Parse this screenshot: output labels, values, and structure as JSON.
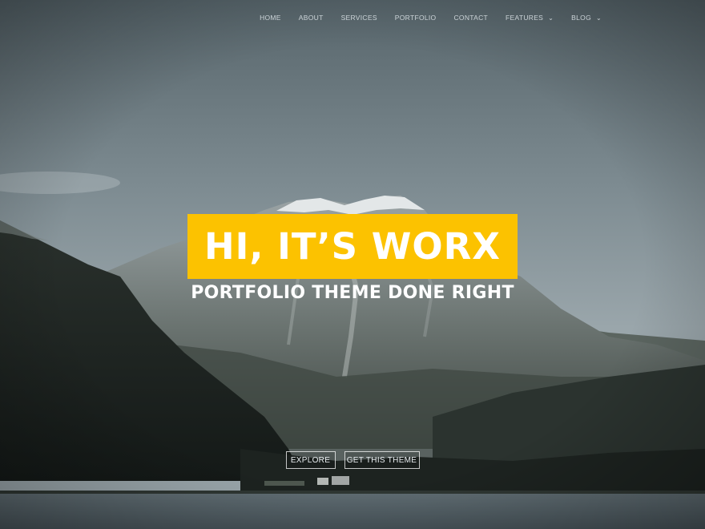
{
  "nav": {
    "items": [
      {
        "label": "HOME",
        "has_dropdown": false
      },
      {
        "label": "ABOUT",
        "has_dropdown": false
      },
      {
        "label": "SERVICES",
        "has_dropdown": false
      },
      {
        "label": "PORTFOLIO",
        "has_dropdown": false
      },
      {
        "label": "CONTACT",
        "has_dropdown": false
      },
      {
        "label": "FEATURES",
        "has_dropdown": true
      },
      {
        "label": "BLOG",
        "has_dropdown": true
      }
    ],
    "dropdown_glyph": "⌄"
  },
  "hero": {
    "headline": "HI, IT’S WORX",
    "subheadline": "PORTFOLIO THEME DONE RIGHT",
    "background_description_icon": "mountain-lake-photo",
    "accent_color": "#fcc200"
  },
  "buttons": {
    "explore": "EXPLORE",
    "get_theme": "GET THIS THEME"
  }
}
